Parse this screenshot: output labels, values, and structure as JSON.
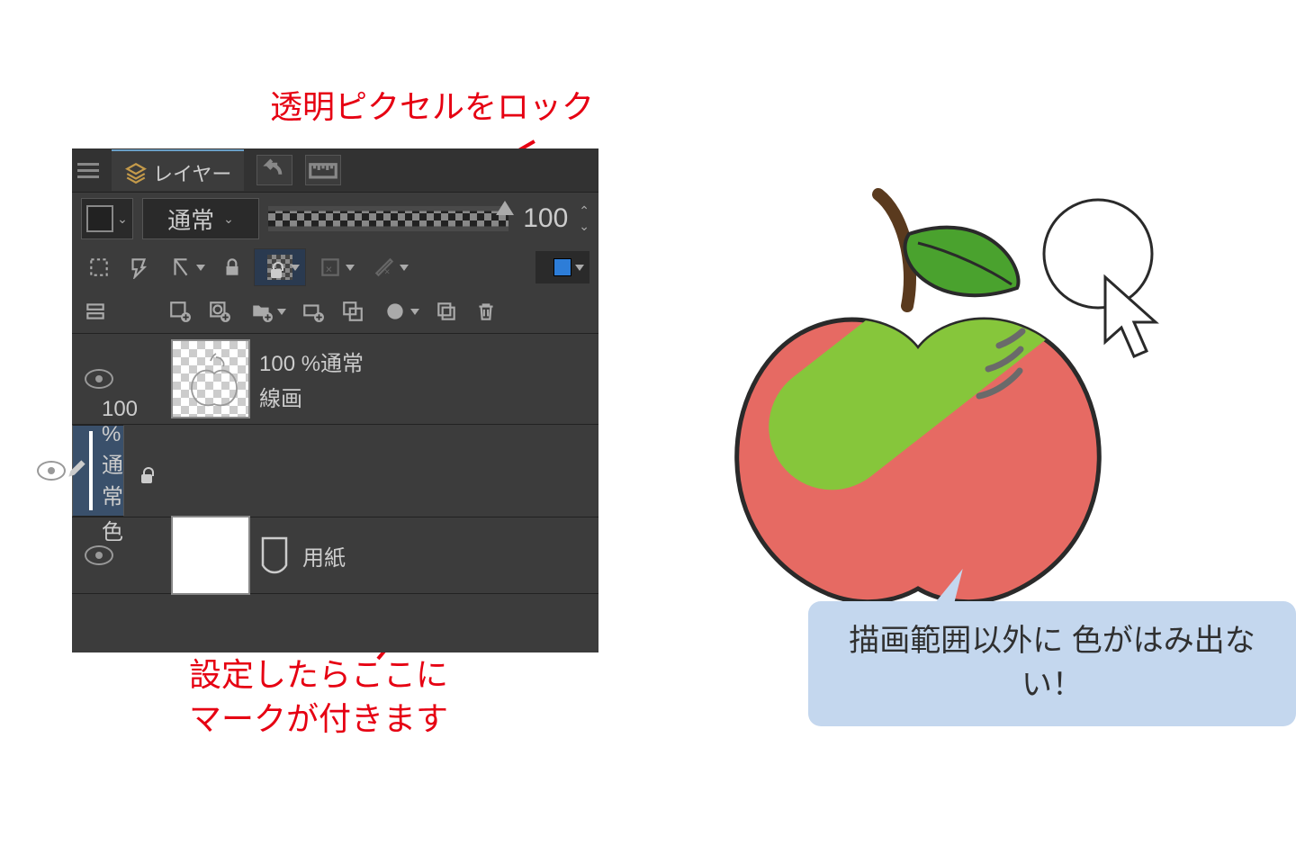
{
  "annotations": {
    "top": "透明ピクセルをロック",
    "bottom": "設定したらここに\nマークが付きます",
    "callout": "描画範囲以外に\n色がはみ出ない！"
  },
  "panel": {
    "tab_label": "レイヤー",
    "blend_mode": "通常",
    "opacity_value": "100",
    "layers": [
      {
        "opacity_line": "100 %通常",
        "name": "線画"
      },
      {
        "opacity_line": "100 %通常",
        "name": "色"
      },
      {
        "name": "用紙"
      }
    ]
  },
  "colors": {
    "accent_red": "#e60012",
    "apple_red": "#e66a63",
    "apple_green": "#86c63b",
    "leaf_green": "#4aa22e",
    "stem": "#5a3a1e",
    "callout_bg": "#c4d7ee"
  }
}
